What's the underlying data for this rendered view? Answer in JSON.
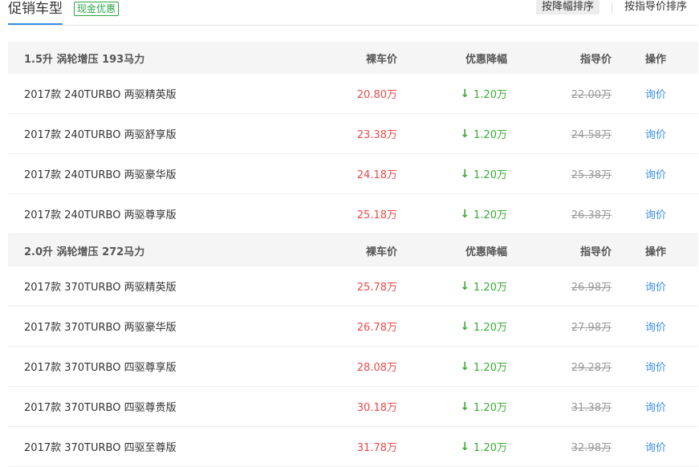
{
  "header": {
    "title": "促销车型",
    "badge": "现金优惠",
    "sort_discount": "按降幅排序",
    "sort_guide": "按指导价排序"
  },
  "groups": [
    {
      "name": "1.5升 涡轮增压 193马力",
      "col_net": "裸车价",
      "col_drop": "优惠降幅",
      "col_guide": "指导价",
      "col_op": "操作",
      "rows": [
        {
          "model": "2017款 240TURBO 两驱精英版",
          "net": "20.80万",
          "drop": "1.20万",
          "guide": "22.00万",
          "action": "询价"
        },
        {
          "model": "2017款 240TURBO 两驱舒享版",
          "net": "23.38万",
          "drop": "1.20万",
          "guide": "24.58万",
          "action": "询价"
        },
        {
          "model": "2017款 240TURBO 两驱豪华版",
          "net": "24.18万",
          "drop": "1.20万",
          "guide": "25.38万",
          "action": "询价"
        },
        {
          "model": "2017款 240TURBO 两驱尊享版",
          "net": "25.18万",
          "drop": "1.20万",
          "guide": "26.38万",
          "action": "询价"
        }
      ]
    },
    {
      "name": "2.0升 涡轮增压 272马力",
      "col_net": "裸车价",
      "col_drop": "优惠降幅",
      "col_guide": "指导价",
      "col_op": "操作",
      "rows": [
        {
          "model": "2017款 370TURBO 两驱精英版",
          "net": "25.78万",
          "drop": "1.20万",
          "guide": "26.98万",
          "action": "询价"
        },
        {
          "model": "2017款 370TURBO 两驱豪华版",
          "net": "26.78万",
          "drop": "1.20万",
          "guide": "27.98万",
          "action": "询价"
        },
        {
          "model": "2017款 370TURBO 四驱尊享版",
          "net": "28.08万",
          "drop": "1.20万",
          "guide": "29.28万",
          "action": "询价"
        },
        {
          "model": "2017款 370TURBO 四驱尊贵版",
          "net": "30.18万",
          "drop": "1.20万",
          "guide": "31.38万",
          "action": "询价"
        },
        {
          "model": "2017款 370TURBO 四驱至尊版",
          "net": "31.78万",
          "drop": "1.20万",
          "guide": "32.98万",
          "action": "询价"
        }
      ]
    }
  ],
  "icons": {
    "drop": "arrow-down-icon"
  },
  "colors": {
    "price": "#e84b4b",
    "drop": "#3aaa35",
    "link": "#3a8ee6",
    "accent": "#3a8ee6"
  }
}
